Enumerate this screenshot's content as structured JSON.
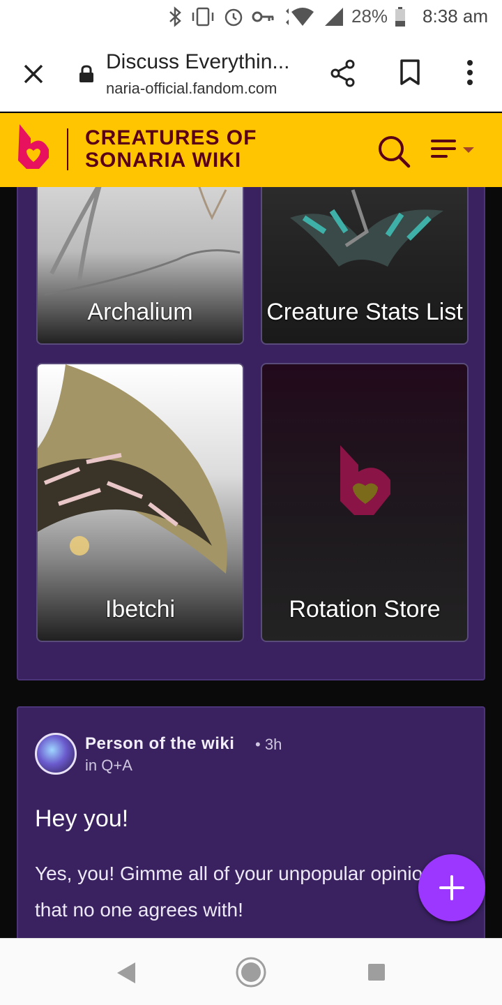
{
  "status_bar": {
    "battery": "28%",
    "time": "8:38 am",
    "icons": [
      "bluetooth-icon",
      "vibrate-icon",
      "alarm-icon",
      "vpn-key-icon",
      "wifi-icon",
      "signal-icon",
      "battery-icon"
    ]
  },
  "browser": {
    "page_title": "Discuss Everythin...",
    "url": "naria-official.fandom.com"
  },
  "wiki": {
    "name_line1": "CREATURES OF",
    "name_line2": "SONARIA WIKI",
    "brand_color": "#ffc500",
    "accent_color": "#5a0014"
  },
  "tiles": [
    {
      "label": "Archalium"
    },
    {
      "label": "Creature Stats List"
    },
    {
      "label": "Ibetchi"
    },
    {
      "label": "Rotation Store"
    }
  ],
  "post": {
    "author": "Person of the wiki",
    "time": "3h",
    "category": "in Q+A",
    "title": "Hey you!",
    "body": "Yes, you! Gimme all of your unpopular opinions that no one agrees with!"
  },
  "fab": {
    "icon": "plus-icon",
    "color": "#9b37ff"
  }
}
